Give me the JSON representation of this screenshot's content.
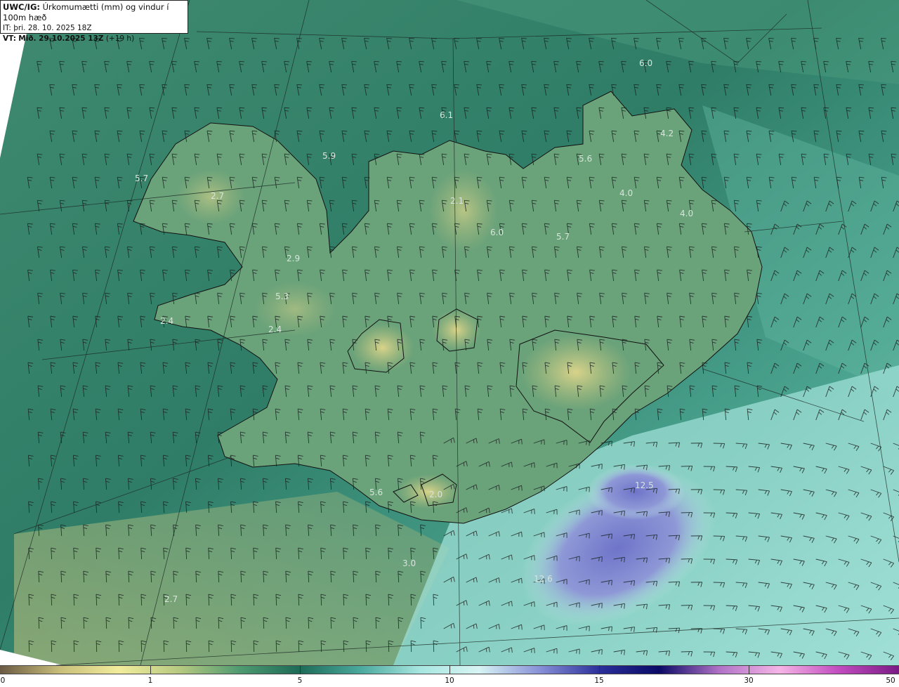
{
  "header": {
    "model": "UWC/IG:",
    "title": "Úrkomumætti (mm) og vindur í 100m hæð",
    "it_label": "IT:",
    "it_value": "þri. 28. 10. 2025 18Z",
    "vt_label": "VT:",
    "vt_value": "Mið. 29.10.2025 13Z",
    "vt_lead": "(+19 h)"
  },
  "map": {
    "point_labels": [
      "6.0",
      "6.1",
      "5.9",
      "5.7",
      "2.7",
      "4.2",
      "5.6",
      "4.0",
      "4.0",
      "2.1",
      "6.0",
      "5.7",
      "2.9",
      "5.3",
      "2.4",
      "2.4",
      "5.6",
      "2.0",
      "12.5",
      "3.0",
      "12.6",
      "2.7"
    ]
  },
  "colorbar": {
    "ticks": [
      "0",
      "1",
      "5",
      "10",
      "15",
      "30",
      "50"
    ],
    "colors": [
      "#6b5a44",
      "#c9bf7a",
      "#f2ec9c",
      "#b6c981",
      "#4f9a71",
      "#1d6b57",
      "#4aa89c",
      "#a7e6e0",
      "#d8f4f4",
      "#8891d8",
      "#2b2f9a",
      "#0a0a66",
      "#b072c7",
      "#f6b5e6",
      "#c24cc0",
      "#7a1a85"
    ]
  }
}
